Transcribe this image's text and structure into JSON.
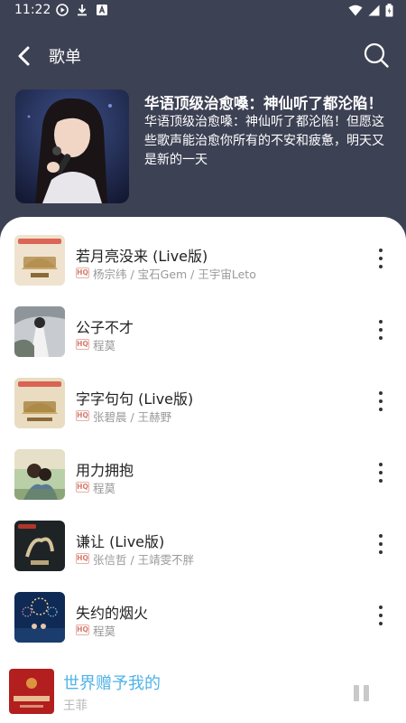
{
  "status_bar": {
    "time": "11:22"
  },
  "header": {
    "title": "歌单"
  },
  "playlist": {
    "title": "华语顶级治愈嗓：神仙听了都沦陷！",
    "description": "华语顶级治愈嗓：神仙听了都沦陷！但愿这些歌声能治愈你所有的不安和疲惫，明天又是新的一天"
  },
  "songs": [
    {
      "title": "若月亮没来 (Live版)",
      "artist": "杨宗纬 / 宝石Gem / 王宇宙Leto",
      "badge": "HQ"
    },
    {
      "title": "公子不才",
      "artist": "程莫",
      "badge": "HQ"
    },
    {
      "title": "字字句句 (Live版)",
      "artist": "张碧晨 / 王赫野",
      "badge": "HQ"
    },
    {
      "title": "用力拥抱",
      "artist": "程莫",
      "badge": "HQ"
    },
    {
      "title": "谦让 (Live版)",
      "artist": "张信哲 / 王靖雯不胖",
      "badge": "HQ"
    },
    {
      "title": "失约的烟火",
      "artist": "程莫",
      "badge": "HQ"
    }
  ],
  "player": {
    "title": "世界赠予我的",
    "artist": "王菲"
  },
  "colors": {
    "header_bg": "#3d4154",
    "accent": "#4fb3e8"
  }
}
